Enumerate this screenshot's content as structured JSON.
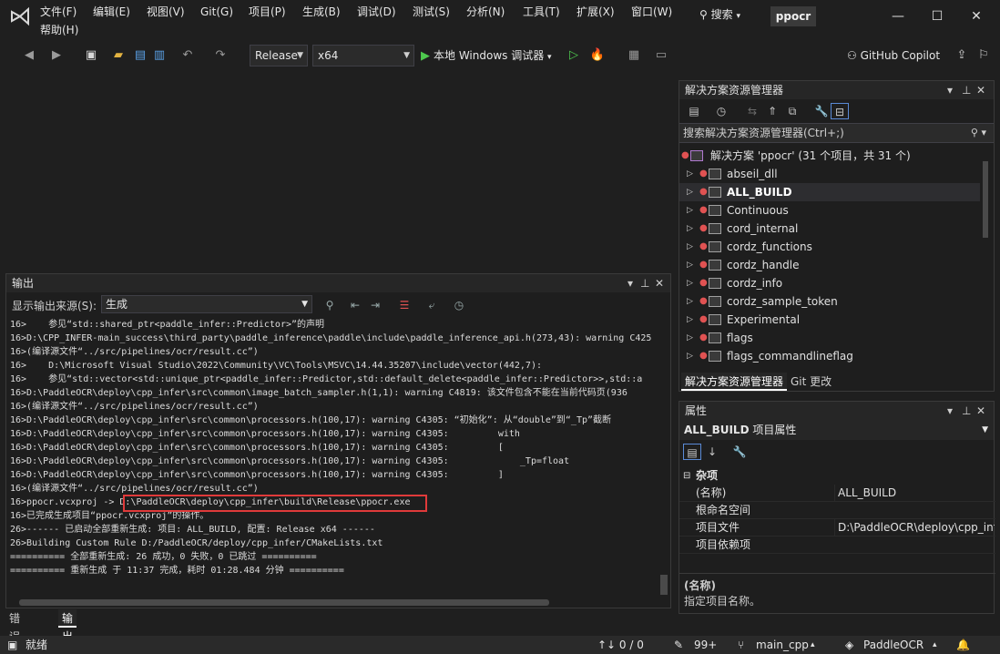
{
  "menu": {
    "items": [
      "文件(F)",
      "编辑(E)",
      "视图(V)",
      "Git(G)",
      "项目(P)",
      "生成(B)",
      "调试(D)",
      "测试(S)",
      "分析(N)",
      "工具(T)",
      "扩展(X)",
      "窗口(W)",
      "帮助(H)"
    ],
    "search_label": "搜索",
    "project_name": "ppocr"
  },
  "toolbar": {
    "config": "Release",
    "platform": "x64",
    "run_label": "本地 Windows 调试器",
    "copilot_label": "GitHub Copilot"
  },
  "output": {
    "title": "输出",
    "source_label": "显示输出来源(S):",
    "source_value": "生成",
    "lines": [
      "16>    参见“std::shared_ptr<paddle_infer::Predictor>”的声明",
      "16>D:\\CPP_INFER-main_success\\third_party\\paddle_inference\\paddle\\include\\paddle_inference_api.h(273,43): warning C425",
      "16>(编译源文件“../src/pipelines/ocr/result.cc”)",
      "16>    D:\\Microsoft Visual Studio\\2022\\Community\\VC\\Tools\\MSVC\\14.44.35207\\include\\vector(442,7):",
      "16>    参见“std::vector<std::unique_ptr<paddle_infer::Predictor,std::default_delete<paddle_infer::Predictor>>,std::a",
      "16>D:\\PaddleOCR\\deploy\\cpp_infer\\src\\common\\image_batch_sampler.h(1,1): warning C4819: 该文件包含不能在当前代码页(936",
      "16>(编译源文件“../src/pipelines/ocr/result.cc”)",
      "16>D:\\PaddleOCR\\deploy\\cpp_infer\\src\\common\\processors.h(100,17): warning C4305: “初始化”: 从“double”到“_Tp”截断",
      "16>D:\\PaddleOCR\\deploy\\cpp_infer\\src\\common\\processors.h(100,17): warning C4305:         with",
      "16>D:\\PaddleOCR\\deploy\\cpp_infer\\src\\common\\processors.h(100,17): warning C4305:         [",
      "16>D:\\PaddleOCR\\deploy\\cpp_infer\\src\\common\\processors.h(100,17): warning C4305:             _Tp=float",
      "16>D:\\PaddleOCR\\deploy\\cpp_infer\\src\\common\\processors.h(100,17): warning C4305:         ]",
      "16>(编译源文件“../src/pipelines/ocr/result.cc”)",
      "16>ppocr.vcxproj -> D:\\PaddleOCR\\deploy\\cpp_infer\\build\\Release\\ppocr.exe",
      "16>已完成生成项目“ppocr.vcxproj”的操作。",
      "26>------ 已启动全部重新生成: 项目: ALL_BUILD, 配置: Release x64 ------",
      "26>Building Custom Rule D:/PaddleOCR/deploy/cpp_infer/CMakeLists.txt",
      "========== 全部重新生成: 26 成功，0 失败，0 已跳过 ==========",
      "========== 重新生成 于 11:37 完成，耗时 01:28.484 分钟 =========="
    ]
  },
  "bottom_tabs": [
    "错误列表",
    "输出"
  ],
  "solution_explorer": {
    "title": "解决方案资源管理器",
    "search_placeholder": "搜索解决方案资源管理器(Ctrl+;)",
    "root": "解决方案 'ppocr' (31 个项目，共 31 个)",
    "items": [
      "abseil_dll",
      "ALL_BUILD",
      "Continuous",
      "cord_internal",
      "cordz_functions",
      "cordz_handle",
      "cordz_info",
      "cordz_sample_token",
      "Experimental",
      "flags",
      "flags_commandlineflag"
    ],
    "selected": "ALL_BUILD",
    "tabs": [
      "解决方案资源管理器",
      "Git 更改"
    ]
  },
  "properties": {
    "title": "属性",
    "object_name": "ALL_BUILD",
    "object_type": "项目属性",
    "category": "杂项",
    "rows": [
      {
        "name": "(名称)",
        "value": "ALL_BUILD"
      },
      {
        "name": "根命名空间",
        "value": ""
      },
      {
        "name": "项目文件",
        "value": "D:\\PaddleOCR\\deploy\\cpp_inf"
      },
      {
        "name": "项目依赖项",
        "value": ""
      }
    ],
    "desc_title": "(名称)",
    "desc_text": "指定项目名称。"
  },
  "status": {
    "ready": "就绪",
    "sync": "↑↓ 0 / 0",
    "edits": "99+",
    "branch": "main_cpp",
    "repo": "PaddleOCR"
  },
  "colors": {
    "accent": "#e03a3a",
    "run_green": "#4ec94e",
    "bg": "#1f1f1f"
  }
}
